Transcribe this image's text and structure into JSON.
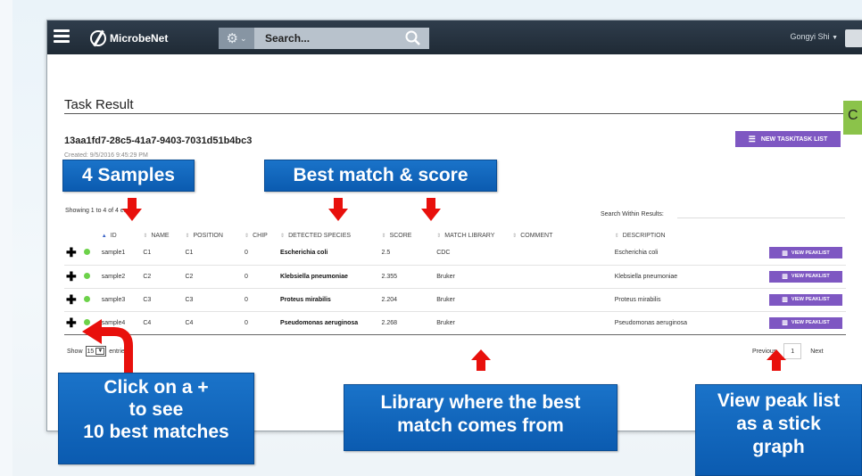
{
  "app": {
    "logo_text": "MicrobeNet",
    "search_placeholder": "Search...",
    "user_name": "Gongyi Shi"
  },
  "page": {
    "title": "Task Result",
    "task_id": "13aa1fd7-28c5-41a7-9403-7031d51b4bc3",
    "created": "Created: 9/5/2016 9:45:29 PM",
    "new_task_button": "NEW TASK/TASK LIST",
    "side_tab_letter": "C",
    "showing_text": "Showing 1 to 4 of 4 entries",
    "search_within_label": "Search Within Results:"
  },
  "table": {
    "columns": [
      "ID",
      "NAME",
      "POSITION",
      "CHIP",
      "DETECTED SPECIES",
      "SCORE",
      "MATCH LIBRARY",
      "COMMENT",
      "DESCRIPTION"
    ],
    "rows": [
      {
        "id": "sample1",
        "name": "C1",
        "position": "C1",
        "chip": "0",
        "species": "Escherichia coli",
        "score": "2.5",
        "library": "CDC",
        "comment": "",
        "description": "Escherichia coli",
        "button": "VIEW PEAKLIST"
      },
      {
        "id": "sample2",
        "name": "C2",
        "position": "C2",
        "chip": "0",
        "species": "Klebsiella pneumoniae",
        "score": "2.355",
        "library": "Bruker",
        "comment": "",
        "description": "Klebsiella pneumoniae",
        "button": "VIEW PEAKLIST"
      },
      {
        "id": "sample3",
        "name": "C3",
        "position": "C3",
        "chip": "0",
        "species": "Proteus mirabilis",
        "score": "2.204",
        "library": "Bruker",
        "comment": "",
        "description": "Proteus mirabilis",
        "button": "VIEW PEAKLIST"
      },
      {
        "id": "sample4",
        "name": "C4",
        "position": "C4",
        "chip": "0",
        "species": "Pseudomonas aeruginosa",
        "score": "2.268",
        "library": "Bruker",
        "comment": "",
        "description": "Pseudomonas aeruginosa",
        "button": "VIEW PEAKLIST"
      }
    ]
  },
  "footer": {
    "show_label": "Show",
    "show_value": "15",
    "entries_label": "entries",
    "previous": "Previous",
    "current_page": "1",
    "next": "Next"
  },
  "callouts": {
    "samples": "4 Samples",
    "best_match": "Best match & score",
    "click_plus": [
      "Click on a +",
      "to see",
      "10 best matches"
    ],
    "library": [
      "Library where the best",
      "match comes from"
    ],
    "peak_list": [
      "View peak list",
      "as a stick",
      "graph"
    ]
  },
  "colors": {
    "topbar": "#26323e",
    "accent_purple": "#7e57c2",
    "status_green": "#6dd24a",
    "callout_blue": "#1166bd",
    "arrow_red": "#e8100c"
  }
}
